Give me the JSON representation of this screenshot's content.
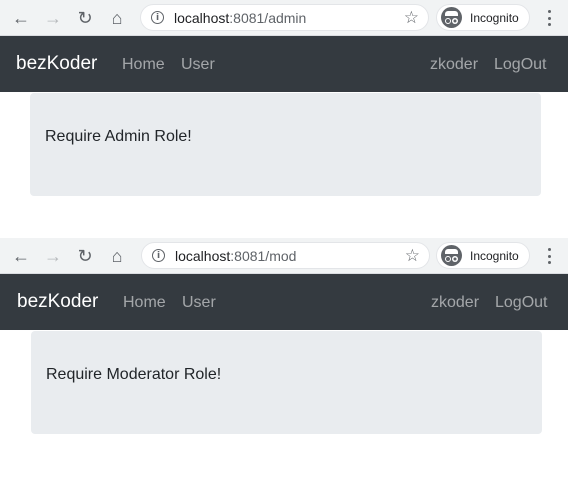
{
  "screens": [
    {
      "browser": {
        "url_host": "localhost",
        "url_rest": ":8081/admin",
        "incognito_label": "Incognito"
      },
      "navbar": {
        "brand": "bezKoder",
        "links": [
          "Home",
          "User"
        ],
        "right_links": [
          "zkoder",
          "LogOut"
        ]
      },
      "content": {
        "message": "Require Admin Role!"
      }
    },
    {
      "browser": {
        "url_host": "localhost",
        "url_rest": ":8081/mod",
        "incognito_label": "Incognito"
      },
      "navbar": {
        "brand": "bezKoder",
        "links": [
          "Home",
          "User"
        ],
        "right_links": [
          "zkoder",
          "LogOut"
        ]
      },
      "content": {
        "message": "Require Moderator Role!"
      }
    }
  ],
  "icons": {
    "back": "arrow-left-icon",
    "forward": "arrow-right-icon",
    "reload": "reload-icon",
    "home": "home-icon",
    "info": "info-icon",
    "bookmark": "star-icon",
    "incognito": "incognito-icon",
    "menu": "kebab-menu-icon"
  },
  "colors": {
    "navbar_bg": "#343a40",
    "jumbotron_bg": "#e9ecef",
    "browser_chrome": "#f1f3f4"
  }
}
